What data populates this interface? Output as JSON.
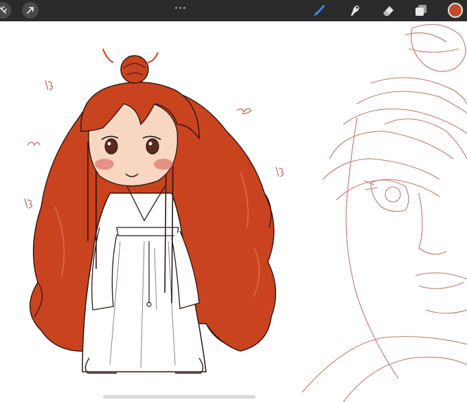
{
  "toolbar": {
    "gallery_tool": "wrench-icon",
    "adjust_tool": "cursor-arrow-icon",
    "more_menu": "more-dots-icon",
    "brush_tool": "brush-icon",
    "smudge_tool": "smudge-icon",
    "eraser_tool": "eraser-icon",
    "layers_tool": "layers-icon",
    "current_color": "#c4492b",
    "active_tool_color": "#3b8bff"
  },
  "canvas": {
    "hair_color": "#c9431f",
    "line_color": "#2a1410",
    "sketch_color": "#b8655a",
    "blush_color": "#e07a72",
    "skin_color": "#f7d7c2"
  }
}
